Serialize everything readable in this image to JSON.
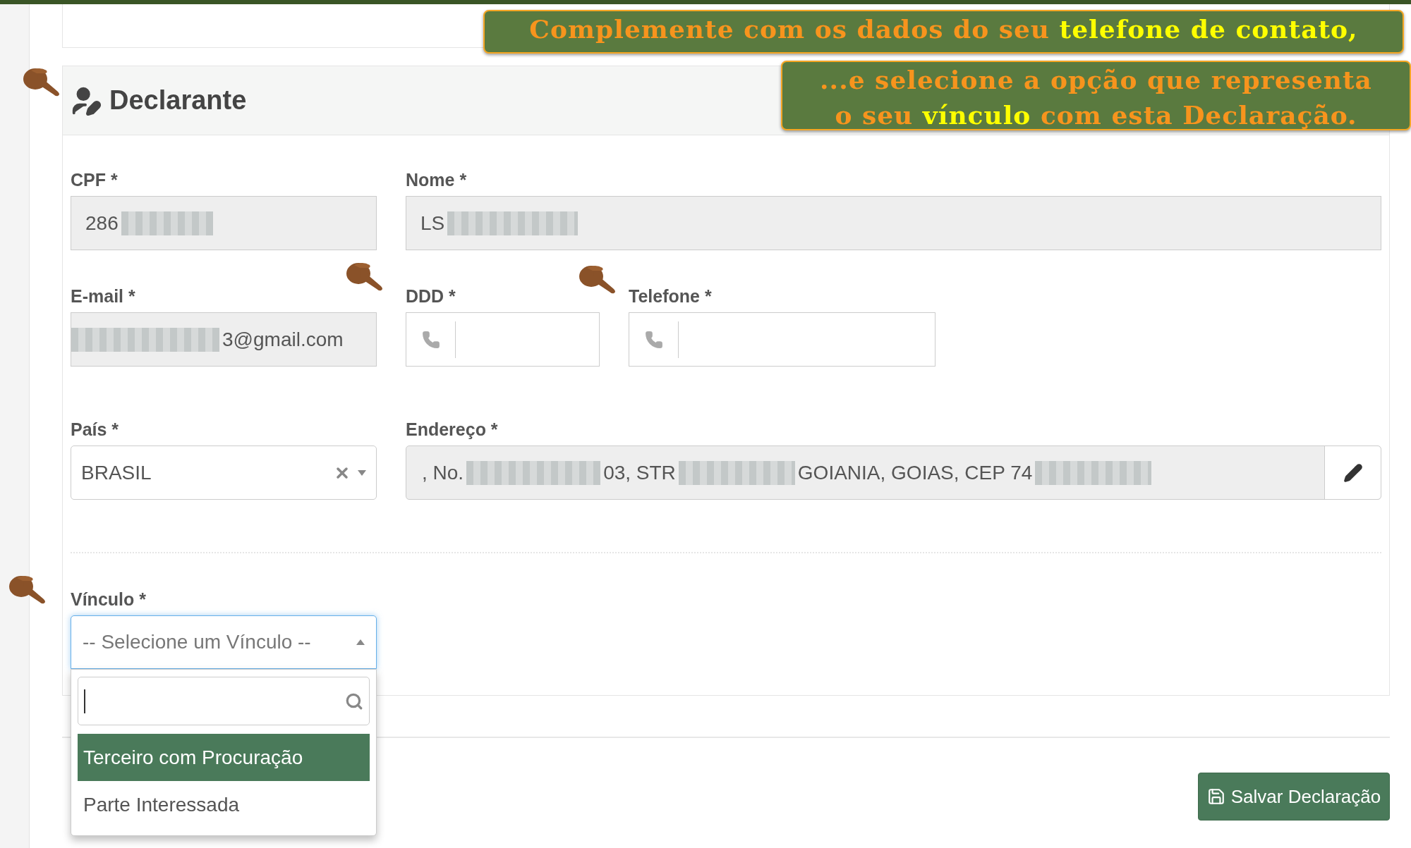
{
  "annotations": [
    {
      "lines": [
        [
          {
            "text": "Complemente com os dados do seu ",
            "highlight": false
          },
          {
            "text": "telefone de contato,",
            "highlight": true
          }
        ]
      ]
    },
    {
      "lines": [
        [
          {
            "text": "...e selecione a opção que representa",
            "highlight": false
          }
        ],
        [
          {
            "text": "o seu ",
            "highlight": false
          },
          {
            "text": "vínculo",
            "highlight": true
          },
          {
            "text": " com esta Declaração.",
            "highlight": false
          }
        ]
      ]
    }
  ],
  "section": {
    "title": "Declarante"
  },
  "form_rows": [
    [
      {
        "kind": "readonly",
        "label": "CPF *",
        "value": [
          {
            "kind": "text",
            "text": "286"
          },
          {
            "kind": "redacted"
          }
        ]
      },
      {
        "kind": "readonly",
        "label": "Nome *",
        "value": [
          {
            "kind": "text",
            "text": "LS"
          },
          {
            "kind": "redacted"
          }
        ]
      }
    ],
    [
      {
        "kind": "readonly",
        "label": "E-mail *",
        "value": [
          {
            "kind": "redacted"
          },
          {
            "kind": "text",
            "text": "3@gmail.com"
          }
        ]
      },
      {
        "kind": "phone",
        "label": "DDD *"
      },
      {
        "kind": "phone",
        "label": "Telefone *"
      }
    ],
    [
      {
        "kind": "select",
        "label": "País *",
        "value": "BRASIL",
        "clearable": true
      },
      {
        "kind": "address",
        "label": "Endereço *",
        "value": [
          {
            "kind": "text",
            "text": ", No."
          },
          {
            "kind": "redacted"
          },
          {
            "kind": "text",
            "text": "03, STR"
          },
          {
            "kind": "redacted"
          },
          {
            "kind": "text",
            "text": "GOIANIA, GOIAS, CEP 74"
          },
          {
            "kind": "redacted"
          }
        ]
      }
    ]
  ],
  "vinculo": {
    "label": "Vínculo *",
    "placeholder": "-- Selecione um Vínculo --",
    "expanded": true,
    "options": [
      {
        "label": "Terceiro com Procuração",
        "selected": true
      },
      {
        "label": "Parte Interessada",
        "selected": false
      }
    ]
  },
  "save_button": {
    "label": "Salvar Declaração"
  }
}
